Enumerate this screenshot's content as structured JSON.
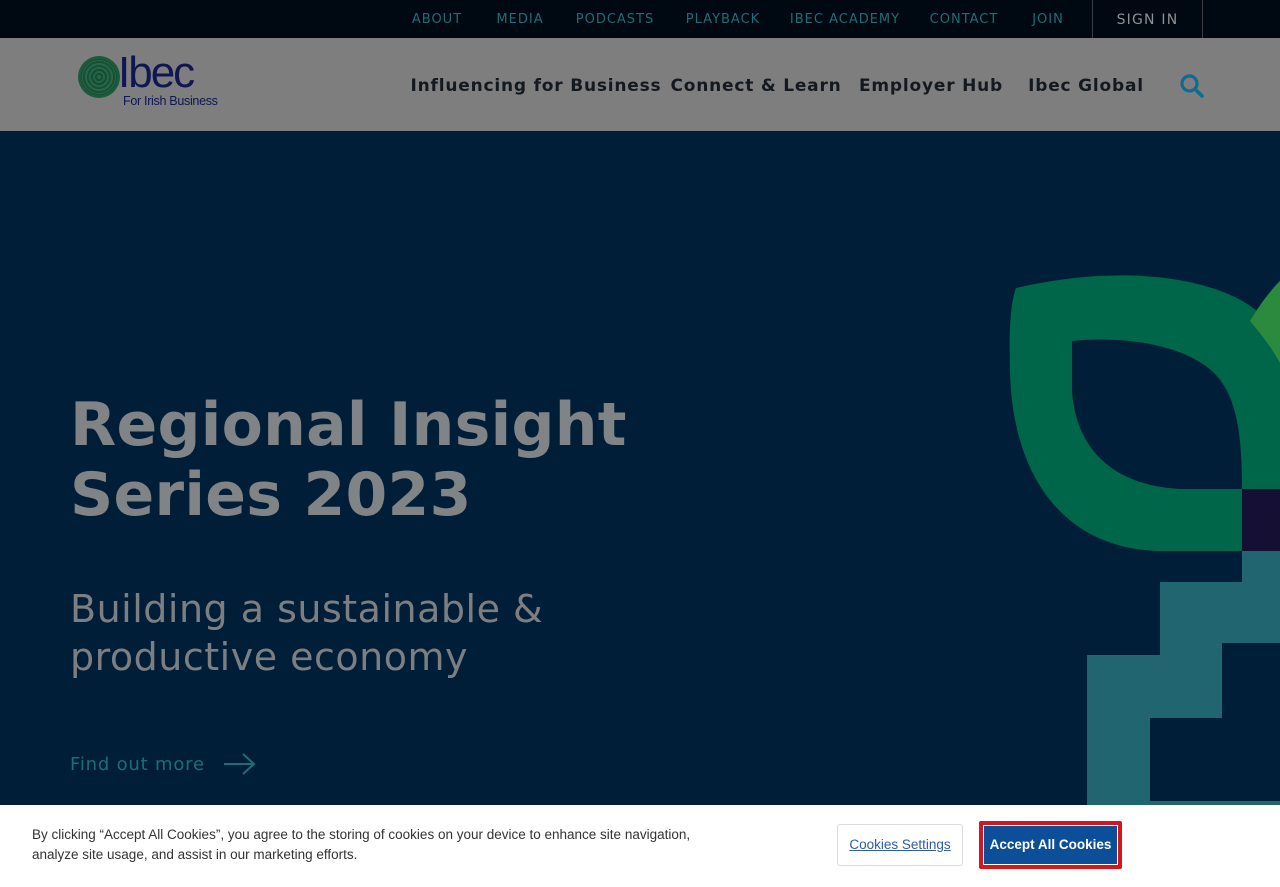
{
  "utility_nav": {
    "items": [
      "ABOUT",
      "MEDIA",
      "PODCASTS",
      "PLAYBACK",
      "IBEC ACADEMY",
      "CONTACT",
      "JOIN"
    ],
    "sign_in": "SIGN IN"
  },
  "logo": {
    "wordmark": "Ibec",
    "tagline": "For Irish Business"
  },
  "main_nav": {
    "items": [
      "Influencing for Business",
      "Connect & Learn",
      "Employer Hub",
      "Ibec Global"
    ],
    "search_icon": "search-icon"
  },
  "hero": {
    "title_lines": [
      "Regional Insight",
      "Series 2023"
    ],
    "subtitle_lines": [
      "Building a sustainable &",
      "productive economy"
    ],
    "cta": "Find out more"
  },
  "cookie_banner": {
    "text_lines": [
      "By clicking “Accept All Cookies”, you agree to the storing of cookies on your device to enhance site navigation,",
      "analyze site usage, and assist in our marketing efforts."
    ],
    "settings_button": "Cookies Settings",
    "accept_button": "Accept All Cookies"
  },
  "colors": {
    "hero_bg": "#001e37",
    "accent_teal": "#1d6e79",
    "shape_green": "#00664a",
    "shape_teal": "#20656f",
    "accept_blue": "#0c4f98",
    "focus_red": "#d3161f"
  }
}
